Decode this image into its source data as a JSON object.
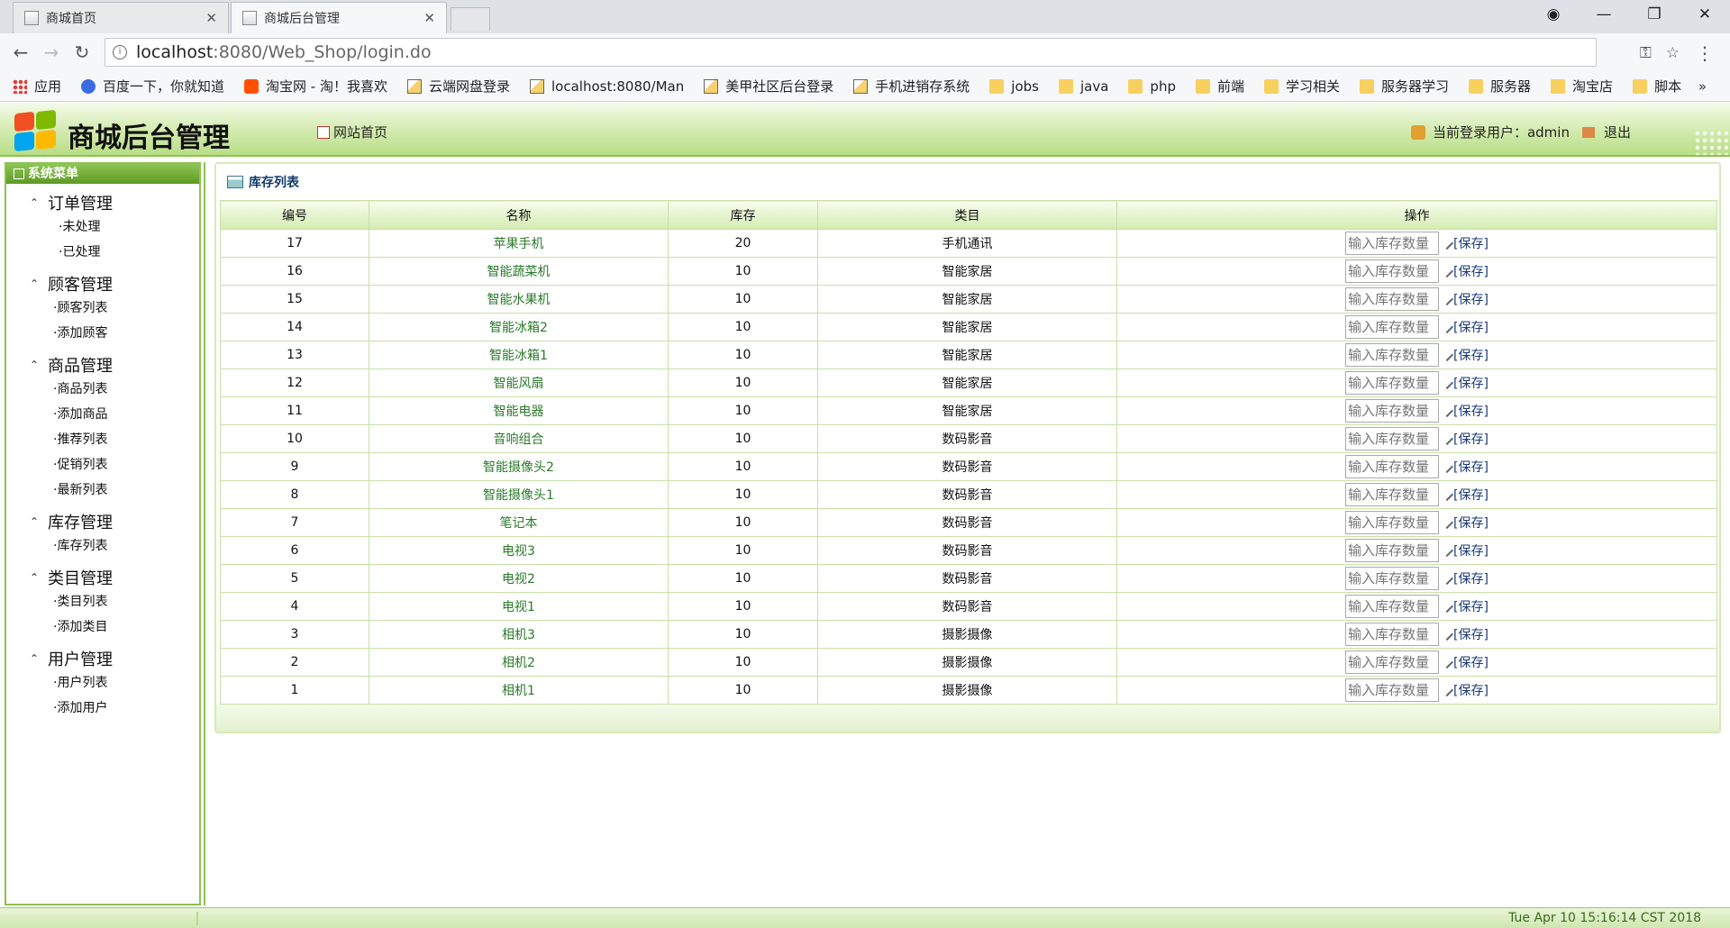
{
  "browser": {
    "tabs": [
      {
        "label": "商城首页",
        "active": false
      },
      {
        "label": "商城后台管理",
        "active": true
      }
    ],
    "url_host": "localhost",
    "url_path": ":8080/Web_Shop/login.do",
    "bookmarks": [
      {
        "label": "应用",
        "icon": "apps-icon"
      },
      {
        "label": "百度一下，你就知道",
        "icon": "baidu-icon"
      },
      {
        "label": "淘宝网 - 淘！我喜欢",
        "icon": "taobao-icon"
      },
      {
        "label": "云端网盘登录",
        "icon": "page-icon"
      },
      {
        "label": "localhost:8080/Man",
        "icon": "page-icon"
      },
      {
        "label": "美甲社区后台登录",
        "icon": "page-icon"
      },
      {
        "label": "手机进销存系统",
        "icon": "page-icon"
      },
      {
        "label": "jobs",
        "icon": "folder-icon"
      },
      {
        "label": "java",
        "icon": "folder-icon"
      },
      {
        "label": "php",
        "icon": "folder-icon"
      },
      {
        "label": "前端",
        "icon": "folder-icon"
      },
      {
        "label": "学习相关",
        "icon": "folder-icon"
      },
      {
        "label": "服务器学习",
        "icon": "folder-icon"
      },
      {
        "label": "服务器",
        "icon": "folder-icon"
      },
      {
        "label": "淘宝店",
        "icon": "folder-icon"
      },
      {
        "label": "脚本",
        "icon": "folder-icon"
      }
    ],
    "more": "»"
  },
  "header": {
    "title": "商城后台管理",
    "home_link": "网站首页",
    "user_label": "当前登录用户：admin",
    "logout": "退出"
  },
  "sidebar": {
    "heading": "系统菜单",
    "groups": [
      {
        "title": "订单管理",
        "items": [
          "·未处理",
          "·已处理"
        ]
      },
      {
        "title": "顾客管理",
        "items": [
          "·顾客列表",
          "·添加顾客"
        ]
      },
      {
        "title": "商品管理",
        "items": [
          "·商品列表",
          "·添加商品",
          "·推荐列表",
          "·促销列表",
          "·最新列表"
        ]
      },
      {
        "title": "库存管理",
        "items": [
          "·库存列表"
        ]
      },
      {
        "title": "类目管理",
        "items": [
          "·类目列表",
          "·添加类目"
        ]
      },
      {
        "title": "用户管理",
        "items": [
          "·用户列表",
          "·添加用户"
        ]
      }
    ]
  },
  "panel": {
    "title": "库存列表",
    "columns": [
      "编号",
      "名称",
      "库存",
      "类目",
      "操作"
    ],
    "input_placeholder": "输入库存数量",
    "save_label": "[保存]",
    "rows": [
      {
        "id": "17",
        "name": "苹果手机",
        "stock": "20",
        "category": "手机通讯"
      },
      {
        "id": "16",
        "name": "智能蔬菜机",
        "stock": "10",
        "category": "智能家居"
      },
      {
        "id": "15",
        "name": "智能水果机",
        "stock": "10",
        "category": "智能家居"
      },
      {
        "id": "14",
        "name": "智能冰箱2",
        "stock": "10",
        "category": "智能家居"
      },
      {
        "id": "13",
        "name": "智能冰箱1",
        "stock": "10",
        "category": "智能家居"
      },
      {
        "id": "12",
        "name": "智能风扇",
        "stock": "10",
        "category": "智能家居"
      },
      {
        "id": "11",
        "name": "智能电器",
        "stock": "10",
        "category": "智能家居"
      },
      {
        "id": "10",
        "name": "音响组合",
        "stock": "10",
        "category": "数码影音"
      },
      {
        "id": "9",
        "name": "智能摄像头2",
        "stock": "10",
        "category": "数码影音"
      },
      {
        "id": "8",
        "name": "智能摄像头1",
        "stock": "10",
        "category": "数码影音"
      },
      {
        "id": "7",
        "name": "笔记本",
        "stock": "10",
        "category": "数码影音"
      },
      {
        "id": "6",
        "name": "电视3",
        "stock": "10",
        "category": "数码影音"
      },
      {
        "id": "5",
        "name": "电视2",
        "stock": "10",
        "category": "数码影音"
      },
      {
        "id": "4",
        "name": "电视1",
        "stock": "10",
        "category": "数码影音"
      },
      {
        "id": "3",
        "name": "相机3",
        "stock": "10",
        "category": "摄影摄像"
      },
      {
        "id": "2",
        "name": "相机2",
        "stock": "10",
        "category": "摄影摄像"
      },
      {
        "id": "1",
        "name": "相机1",
        "stock": "10",
        "category": "摄影摄像"
      }
    ]
  },
  "statusbar": {
    "time": "Tue Apr 10 15:16:14 CST 2018"
  },
  "colors": {
    "accent_green": "#8dc24f",
    "header_bg": "#cfe9a9",
    "link_green": "#2a7a2a"
  }
}
